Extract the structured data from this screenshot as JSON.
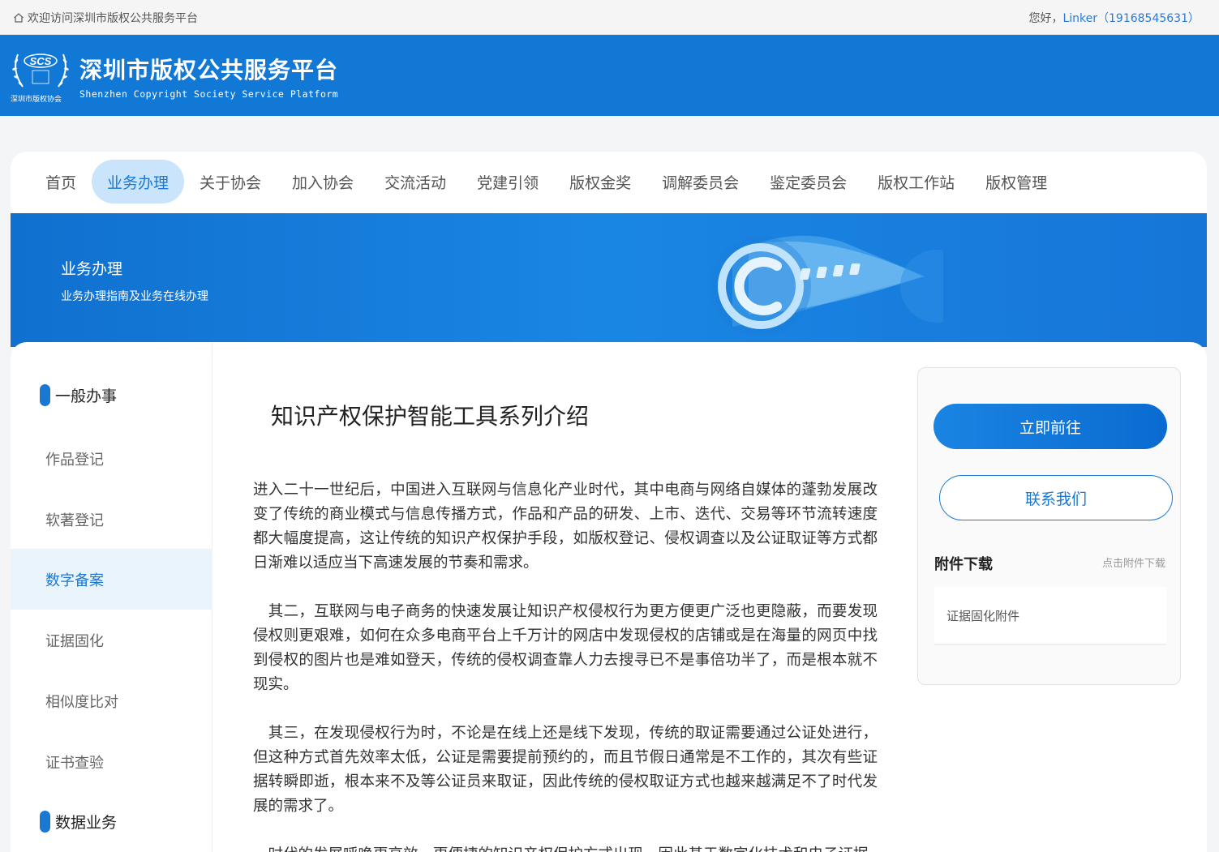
{
  "topbar": {
    "welcome": "欢迎访问深圳市版权公共服务平台",
    "greeting": "您好，",
    "user": "Linker（19168545631）"
  },
  "header": {
    "logo_abbr": "SCS",
    "logo_sub": "深圳市版权协会",
    "title_cn": "深圳市版权公共服务平台",
    "title_en": "Shenzhen Copyright Society Service Platform"
  },
  "nav": {
    "items": [
      "首页",
      "业务办理",
      "关于协会",
      "加入协会",
      "交流活动",
      "党建引领",
      "版权金奖",
      "调解委员会",
      "鉴定委员会",
      "版权工作站",
      "版权管理"
    ],
    "active_index": 1
  },
  "banner": {
    "title": "业务办理",
    "subtitle": "业务办理指南及业务在线办理"
  },
  "sidebar": {
    "group1": "一般办事",
    "items": [
      "作品登记",
      "软著登记",
      "数字备案",
      "证据固化",
      "相似度比对",
      "证书查验"
    ],
    "active_index": 2,
    "group2": "数据业务"
  },
  "article": {
    "title": "知识产权保护智能工具系列介绍",
    "paragraphs": [
      "进入二十一世纪后，中国进入互联网与信息化产业时代，其中电商与网络自媒体的蓬勃发展改变了传统的商业模式与信息传播方式，作品和产品的研发、上市、迭代、交易等环节流转速度都大幅度提高，这让传统的知识产权保护手段，如版权登记、侵权调查以及公证取证等方式都日渐难以适应当下高速发展的节奏和需求。",
      "　其二，互联网与电子商务的快速发展让知识产权侵权行为更方便更广泛也更隐蔽，而要发现侵权则更艰难，如何在众多电商平台上千万计的网店中发现侵权的店铺或是在海量的网页中找到侵权的图片也是难如登天，传统的侵权调查靠人力去搜寻已不是事倍功半了，而是根本就不现实。",
      "　其三，在发现侵权行为时，不论是在线上还是线下发现，传统的取证需要通过公证处进行，但这种方式首先效率太低，公证是需要提前预约的，而且节假日通常是不工作的，其次有些证据转瞬即逝，根本来不及等公证员来取证，因此传统的侵权取证方式也越来越满足不了时代发展的需求了。",
      "　时代的发展呼唤更高效、更便捷的知识产权保护方式出现，因此基于数字化技术和电子证据"
    ]
  },
  "rightbox": {
    "go_button": "立即前往",
    "contact_button": "联系我们",
    "attachments_title": "附件下载",
    "attachments_hint": "点击附件下载",
    "attachments": [
      "证据固化附件"
    ]
  },
  "colors": {
    "brand_blue": "#1278d6",
    "active_nav_bg": "#c9e4fb"
  }
}
